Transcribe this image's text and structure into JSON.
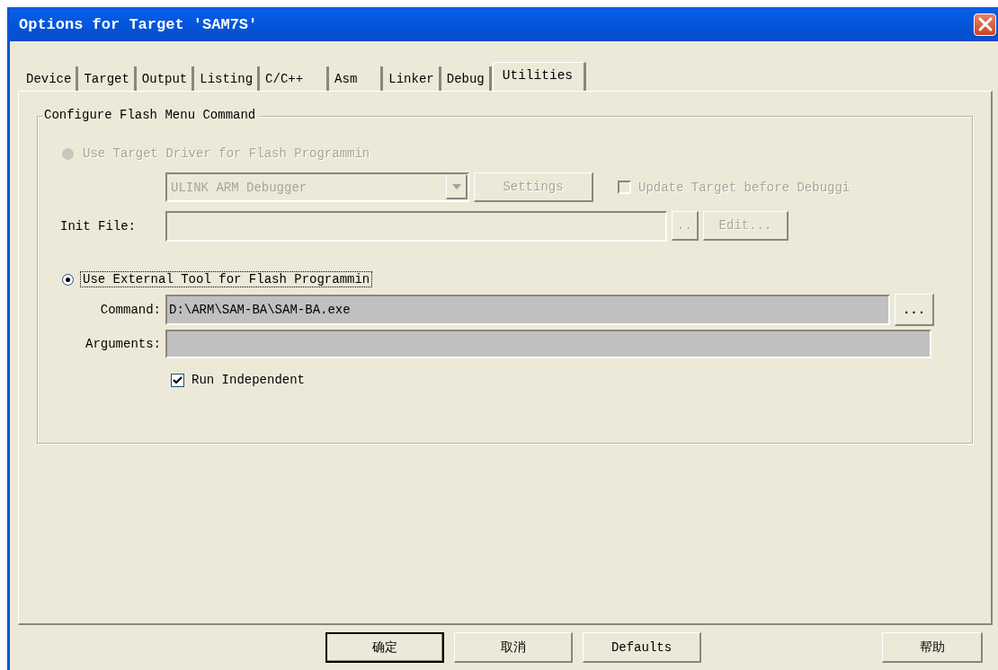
{
  "window": {
    "title": "Options for Target 'SAM7S'"
  },
  "tabs": [
    {
      "label": "Device",
      "selected": false
    },
    {
      "label": "Target",
      "selected": false
    },
    {
      "label": "Output",
      "selected": false
    },
    {
      "label": "Listing",
      "selected": false
    },
    {
      "label": "C/C++",
      "selected": false
    },
    {
      "label": "Asm",
      "selected": false
    },
    {
      "label": "Linker",
      "selected": false
    },
    {
      "label": "Debug",
      "selected": false
    },
    {
      "label": "Utilities",
      "selected": true
    }
  ],
  "group": {
    "title": "Configure Flash Menu Command",
    "target_driver": {
      "label": "Use Target Driver for Flash Programmin",
      "selected": false,
      "disabled": true,
      "driver_select": {
        "value": "ULINK ARM Debugger",
        "disabled": true
      },
      "settings_button": {
        "label": "Settings",
        "disabled": true
      },
      "update_checkbox": {
        "label": "Update Target before Debuggi",
        "checked": false,
        "disabled": true
      },
      "init_file": {
        "label": "Init File:",
        "disabled": true
      },
      "browse_button": {
        "label": "..",
        "disabled": true
      },
      "edit_button": {
        "label": "Edit...",
        "disabled": true
      }
    },
    "external_tool": {
      "label": "Use External Tool for Flash Programmin",
      "selected": true,
      "command": {
        "label": "Command:",
        "value": "D:\\ARM\\SAM-BA\\SAM-BA.exe"
      },
      "browse_button": {
        "label": "..."
      },
      "arguments": {
        "label": "Arguments:"
      },
      "run_independent": {
        "label": "Run Independent",
        "checked": true
      }
    }
  },
  "buttons": [
    {
      "label": "确定",
      "default": true
    },
    {
      "label": "取消",
      "default": false
    },
    {
      "label": "Defaults",
      "default": false
    },
    {
      "label": "帮助",
      "default": false
    }
  ]
}
